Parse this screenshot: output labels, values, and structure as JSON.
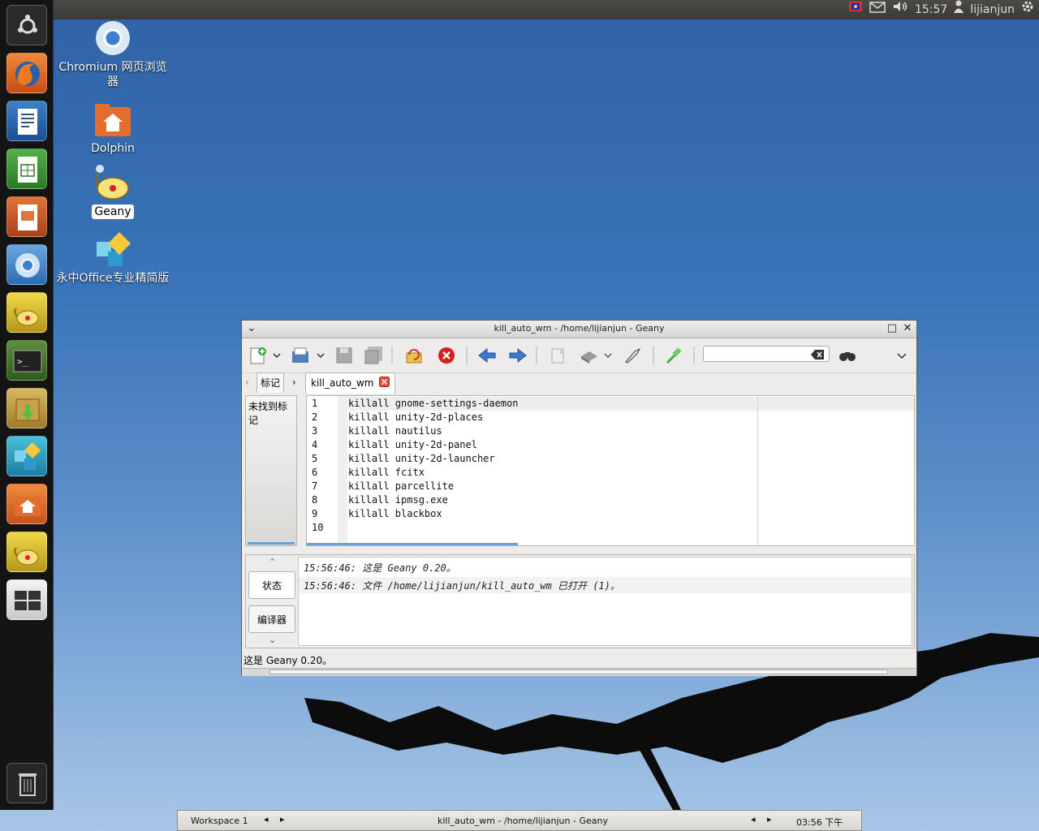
{
  "top_panel": {
    "clock": "15:57",
    "user": "lijianjun"
  },
  "desktop": {
    "icons": [
      {
        "label": "Chromium 网页浏览器"
      },
      {
        "label": "Dolphin"
      },
      {
        "label": "Geany"
      },
      {
        "label": "永中Office专业精简版"
      }
    ]
  },
  "window": {
    "title": "kill_auto_wm - /home/lijianjun - Geany",
    "sidebar_tab": "标记",
    "document_tab": "kill_auto_wm",
    "sidebar_message": "未找到标记",
    "search_placeholder": "",
    "code_lines": [
      {
        "n": "1",
        "text": "killall gnome-settings-daemon"
      },
      {
        "n": "2",
        "text": "killall unity-2d-places"
      },
      {
        "n": "3",
        "text": "killall nautilus"
      },
      {
        "n": "4",
        "text": "killall unity-2d-panel"
      },
      {
        "n": "5",
        "text": "killall unity-2d-launcher"
      },
      {
        "n": "6",
        "text": "killall fcitx"
      },
      {
        "n": "7",
        "text": "killall parcellite"
      },
      {
        "n": "8",
        "text": "killall ipmsg.exe"
      },
      {
        "n": "9",
        "text": "killall blackbox"
      },
      {
        "n": "10",
        "text": ""
      }
    ],
    "message_tabs": [
      "状态",
      "编译器"
    ],
    "messages": [
      "15:56:46: 这是 Geany 0.20。",
      "15:56:46: 文件 /home/lijianjun/kill_auto_wm 已打开 (1)。"
    ],
    "status": "这是 Geany 0.20。"
  },
  "bottom_panel": {
    "workspace": "Workspace 1",
    "task": "kill_auto_wm - /home/lijianjun - Geany",
    "clock": "03:56 下午"
  },
  "colors": {
    "accent_blue": "#6ca0d8",
    "launcher_bg": "#141414",
    "panel_bg": "#3a3935"
  }
}
